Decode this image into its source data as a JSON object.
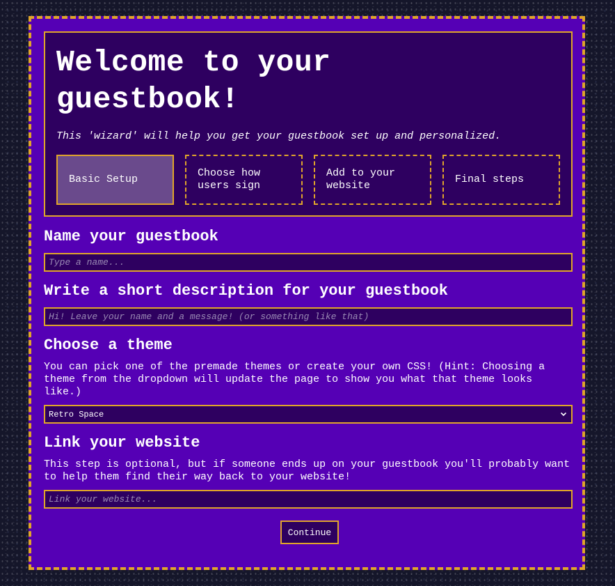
{
  "header": {
    "title": "Welcome to your guestbook!",
    "subtitle": "This 'wizard' will help you get your guestbook set up and personalized."
  },
  "steps": [
    {
      "label": "Basic Setup",
      "active": true
    },
    {
      "label": "Choose how users sign",
      "active": false
    },
    {
      "label": "Add to your website",
      "active": false
    },
    {
      "label": "Final steps",
      "active": false
    }
  ],
  "name_section": {
    "heading": "Name your guestbook",
    "placeholder": "Type a name..."
  },
  "description_section": {
    "heading": "Write a short description for your guestbook",
    "placeholder": "Hi! Leave your name and a message! (or something like that)"
  },
  "theme_section": {
    "heading": "Choose a theme",
    "help": "You can pick one of the premade themes or create your own CSS! (Hint: Choosing a theme from the dropdown will update the page to show you what that theme looks like.)",
    "selected": "Retro Space",
    "icon": "chevron-down-icon"
  },
  "website_section": {
    "heading": "Link your website",
    "help": "This step is optional, but if someone ends up on your guestbook you'll probably want to help them find their way back to your website!",
    "placeholder": "Link your website..."
  },
  "continue_label": "Continue",
  "colors": {
    "page_bg": "#15162a",
    "panel": "#5500b5",
    "header_bg": "#2e0060",
    "accent": "#e0a52a",
    "active_step": "#6a4a8c"
  }
}
